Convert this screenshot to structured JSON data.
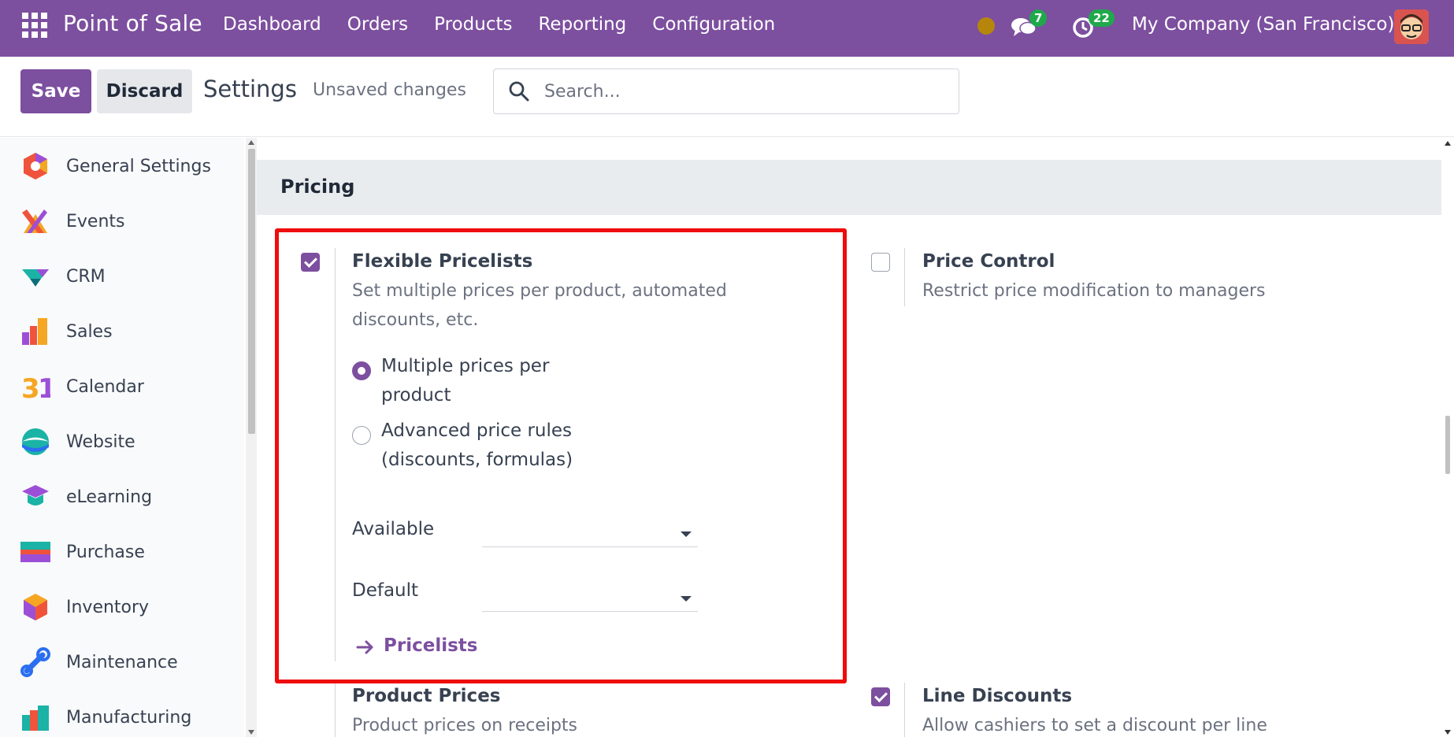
{
  "navbar": {
    "brand": "Point of Sale",
    "menu": [
      "Dashboard",
      "Orders",
      "Products",
      "Reporting",
      "Configuration"
    ],
    "chat_count": "7",
    "activity_count": "22",
    "company": "My Company (San Francisco)"
  },
  "control": {
    "save_label": "Save",
    "discard_label": "Discard",
    "title": "Settings",
    "status": "Unsaved changes",
    "search_placeholder": "Search..."
  },
  "sidebar": {
    "items": [
      {
        "label": "General Settings",
        "icon": "general-settings-icon"
      },
      {
        "label": "Events",
        "icon": "events-icon"
      },
      {
        "label": "CRM",
        "icon": "crm-icon"
      },
      {
        "label": "Sales",
        "icon": "sales-icon"
      },
      {
        "label": "Calendar",
        "icon": "calendar-icon"
      },
      {
        "label": "Website",
        "icon": "website-icon"
      },
      {
        "label": "eLearning",
        "icon": "elearning-icon"
      },
      {
        "label": "Purchase",
        "icon": "purchase-icon"
      },
      {
        "label": "Inventory",
        "icon": "inventory-icon"
      },
      {
        "label": "Maintenance",
        "icon": "maintenance-icon"
      },
      {
        "label": "Manufacturing",
        "icon": "manufacturing-icon"
      }
    ]
  },
  "section": {
    "title": "Pricing",
    "flexible_pricelists": {
      "title": "Flexible Pricelists",
      "description": "Set multiple prices per product, automated discounts, etc.",
      "checked": true,
      "options": [
        {
          "label": "Multiple prices per product",
          "selected": true
        },
        {
          "label": "Advanced price rules (discounts, formulas)",
          "selected": false
        }
      ],
      "available_label": "Available",
      "default_label": "Default",
      "link_label": "Pricelists"
    },
    "price_control": {
      "title": "Price Control",
      "description": "Restrict price modification to managers",
      "checked": false
    },
    "product_prices": {
      "title": "Product Prices",
      "description": "Product prices on receipts"
    },
    "line_discounts": {
      "title": "Line Discounts",
      "description": "Allow cashiers to set a discount per line",
      "checked": true
    }
  },
  "colors": {
    "brand": "#7c4f9f",
    "highlight": "#ee0c0c",
    "badge": "#1fa94b"
  }
}
